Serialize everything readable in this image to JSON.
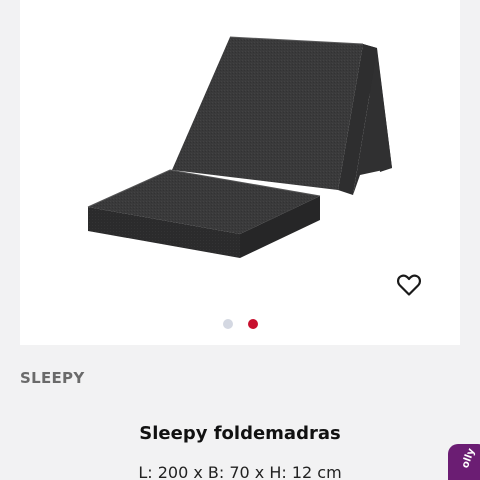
{
  "product": {
    "brand": "SLEEPY",
    "title": "Sleepy foldemadras",
    "dimensions": "L: 200 x B: 70 x H: 12 cm",
    "image_alt": "dark grey folding mattress"
  },
  "gallery": {
    "dot_count": 2,
    "active_index": 1,
    "inactive_color": "#d4d8e2",
    "active_color": "#c8102e"
  },
  "wishlist": {
    "icon": "heart-outline-icon"
  },
  "side_badge": {
    "text": "olly",
    "color": "#6b1d73"
  }
}
